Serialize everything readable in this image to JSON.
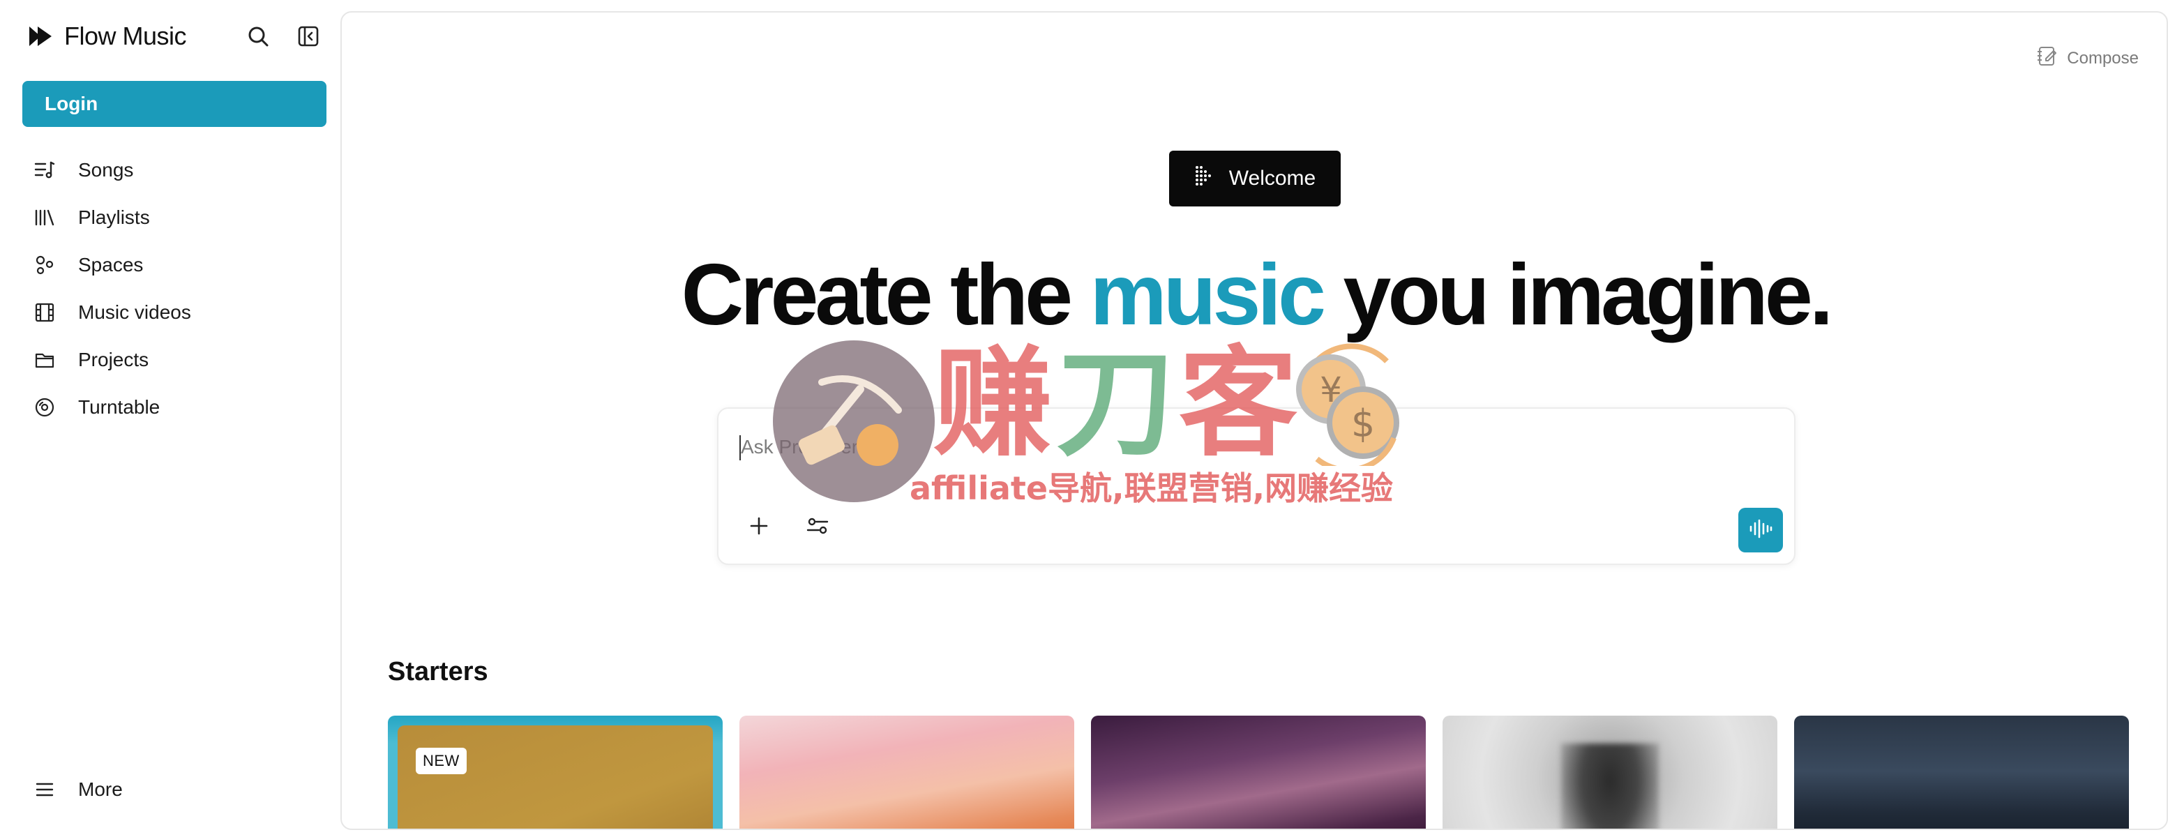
{
  "brand": {
    "name": "Flow Music"
  },
  "sidebar": {
    "login_label": "Login",
    "items": [
      {
        "label": "Songs",
        "icon": "songs-icon"
      },
      {
        "label": "Playlists",
        "icon": "library-icon"
      },
      {
        "label": "Spaces",
        "icon": "spaces-icon"
      },
      {
        "label": "Music videos",
        "icon": "film-icon"
      },
      {
        "label": "Projects",
        "icon": "folder-icon"
      },
      {
        "label": "Turntable",
        "icon": "disc-icon"
      }
    ],
    "more_label": "More"
  },
  "header": {
    "compose_label": "Compose"
  },
  "hero": {
    "badge": "Welcome",
    "title_pre": "Create the ",
    "title_accent": "music",
    "title_post": " you imagine."
  },
  "prompt": {
    "placeholder": "Ask Producer..."
  },
  "starters": {
    "title": "Starters",
    "cards": [
      {
        "badge": "NEW"
      },
      {},
      {},
      {},
      {}
    ]
  },
  "watermark": {
    "chars_a": "赚",
    "chars_b": "刀",
    "chars_c": "客",
    "subtitle": "affiliate导航,联盟营销,网赚经验"
  },
  "colors": {
    "accent": "#1b9bba",
    "text": "#0a0a0a",
    "badge_bg": "#0a0a0a"
  }
}
